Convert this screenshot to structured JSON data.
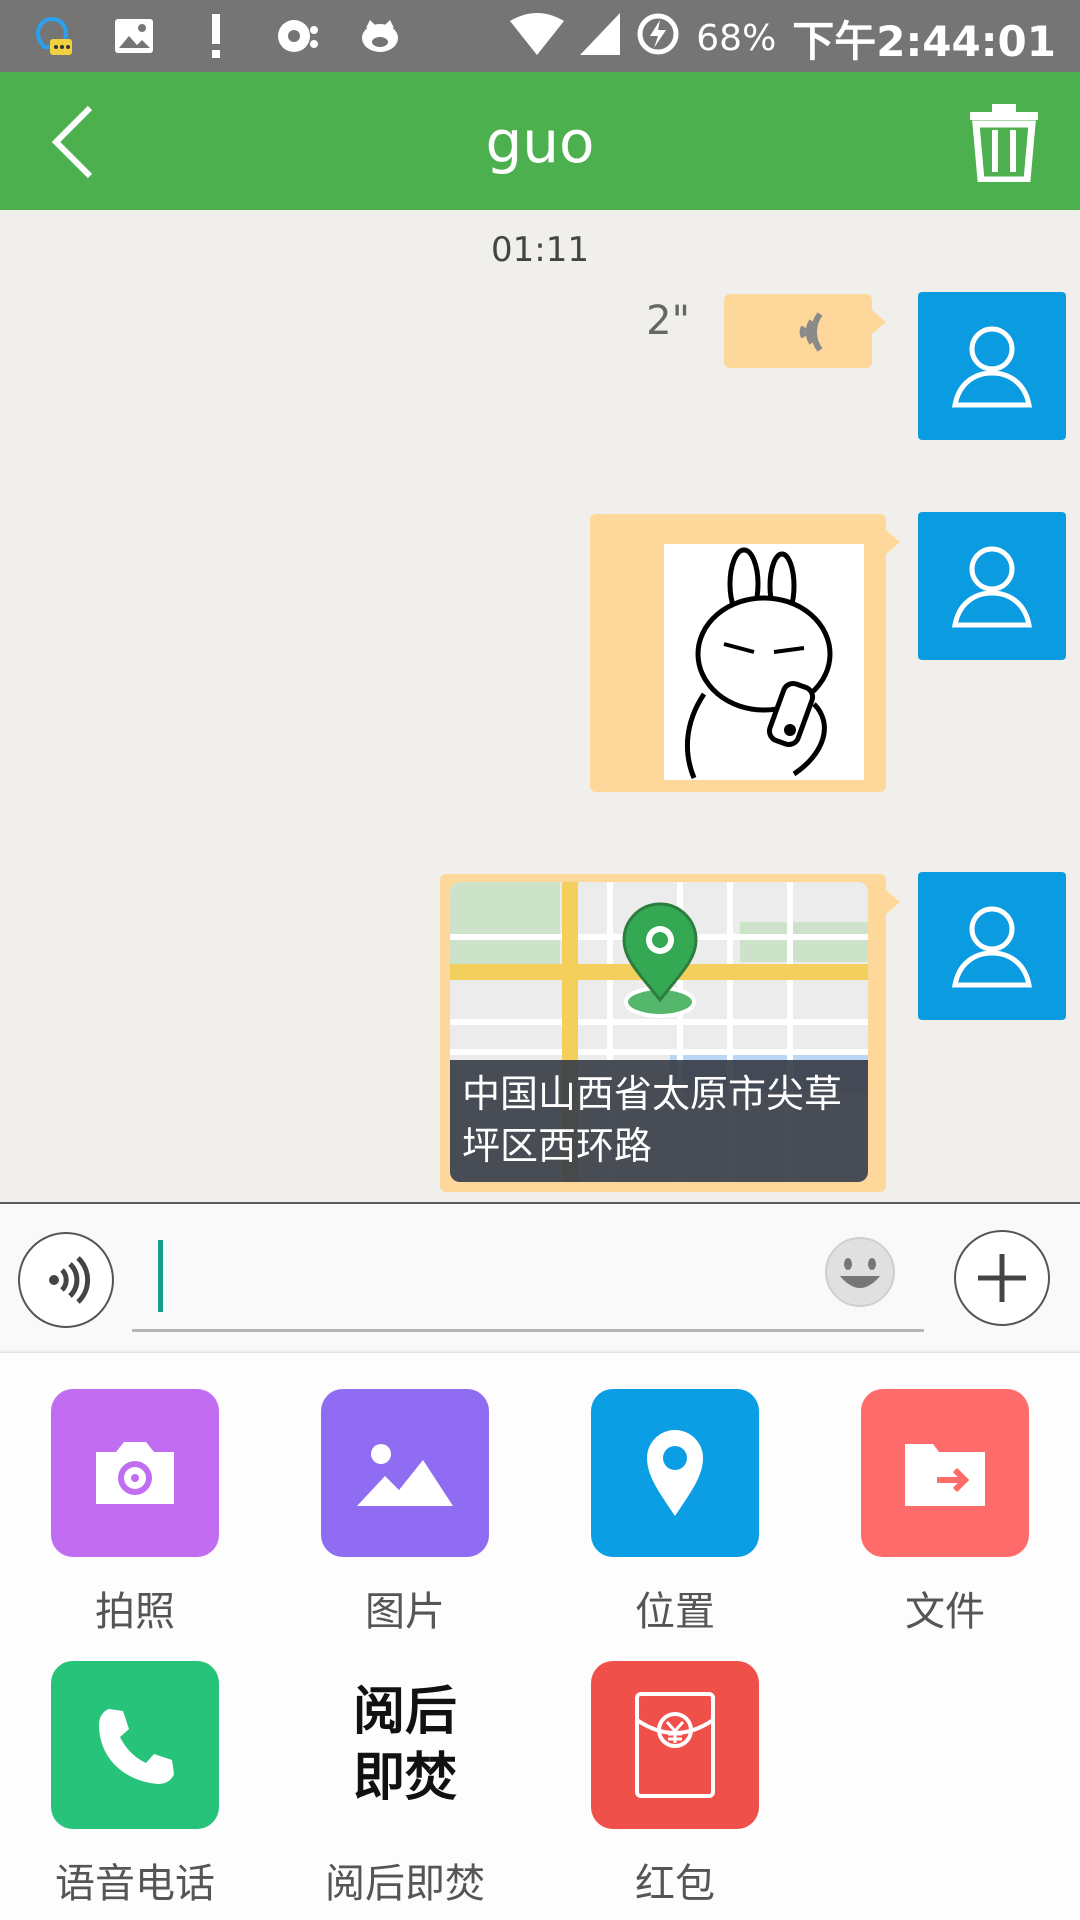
{
  "status_bar": {
    "battery_percent": "68%",
    "time": "下午2:44:01",
    "icons": [
      "notification-icon",
      "image-icon",
      "alert-icon",
      "headset-icon",
      "pig-icon",
      "wifi-icon",
      "signal-icon",
      "battery-charging-icon"
    ]
  },
  "app_bar": {
    "title": "guo",
    "back_icon": "chevron-left-icon",
    "delete_icon": "trash-icon"
  },
  "chat": {
    "timestamp": "01:11",
    "messages": [
      {
        "type": "voice",
        "duration_label": "2\""
      },
      {
        "type": "sticker",
        "description_icon": "rabbit-sticker"
      },
      {
        "type": "location",
        "address": "中国山西省太原市尖草坪区西环路"
      }
    ]
  },
  "input": {
    "value": "",
    "voice_icon": "voice-toggle-icon",
    "emoji_icon": "smiley-icon",
    "plus_icon": "plus-icon"
  },
  "panel": {
    "items": [
      {
        "label": "拍照",
        "icon": "camera-icon",
        "color": "#c06df2"
      },
      {
        "label": "图片",
        "icon": "picture-icon",
        "color": "#8f6cf2"
      },
      {
        "label": "位置",
        "icon": "location-pin-icon",
        "color": "#0b9ee5"
      },
      {
        "label": "文件",
        "icon": "folder-icon",
        "color": "#fd6b6b"
      },
      {
        "label": "语音电话",
        "icon": "phone-icon",
        "color": "#27c37a"
      },
      {
        "label": "阅后即焚",
        "icon": "burn-after-reading-icon",
        "icon_text_1": "阅后",
        "icon_text_2": "即焚"
      },
      {
        "label": "红包",
        "icon": "red-packet-icon",
        "color": "#f0504a"
      }
    ]
  },
  "colors": {
    "status_bar": "#757575",
    "app_bar": "#4db04f",
    "chat_bg": "#f1efeb",
    "bubble": "#fed89a",
    "avatar": "#0a9be0"
  }
}
